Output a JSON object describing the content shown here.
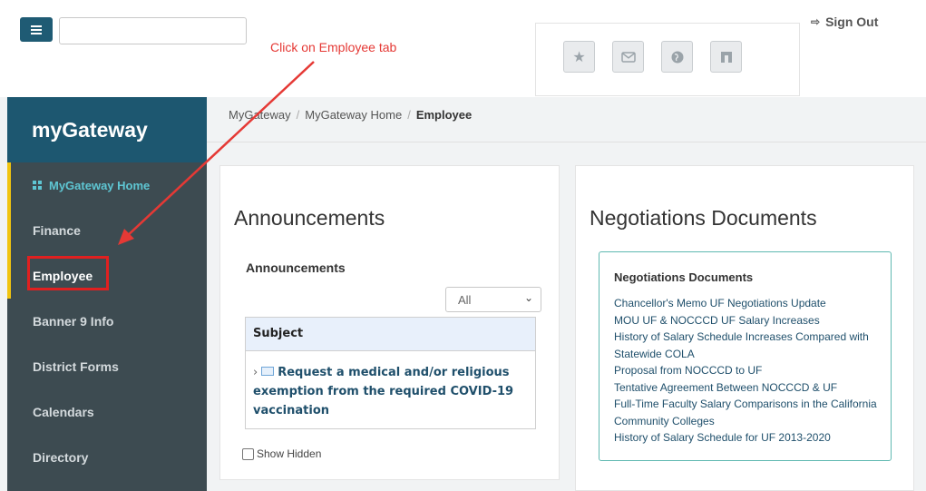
{
  "header": {
    "search_placeholder": "",
    "icons": [
      "star-icon",
      "mail-icon",
      "globe-icon",
      "app-icon"
    ],
    "sign_out_label": "Sign Out"
  },
  "annotation": {
    "text": "Click on Employee tab",
    "color": "#e53935"
  },
  "sidebar": {
    "brand": "myGateway",
    "items": [
      {
        "label": "MyGateway Home"
      },
      {
        "label": "Finance"
      },
      {
        "label": "Employee"
      },
      {
        "label": "Banner 9 Info"
      },
      {
        "label": "District Forms"
      },
      {
        "label": "Calendars"
      },
      {
        "label": "Directory"
      }
    ]
  },
  "breadcrumb": {
    "items": [
      "MyGateway",
      "MyGateway Home",
      "Employee"
    ]
  },
  "announcements": {
    "title": "Announcements",
    "subtitle": "Announcements",
    "filter_value": "All",
    "table_header": "Subject",
    "rows": [
      "Request a medical and/or religious exemption from the required COVID-19 vaccination"
    ],
    "show_hidden_label": "Show Hidden"
  },
  "negotiations": {
    "title": "Negotiations Documents",
    "box_title": "Negotiations Documents",
    "links": [
      "Chancellor's Memo UF Negotiations Update",
      "MOU UF & NOCCCD UF Salary Increases",
      "History of Salary Schedule Increases Compared with Statewide COLA",
      "Proposal from NOCCCD to UF",
      "Tentative Agreement Between NOCCCD & UF",
      "Full-Time Faculty Salary Comparisons in the California Community Colleges",
      "History of Salary Schedule for UF 2013-2020"
    ]
  },
  "colors": {
    "brand_bg": "#1d5770",
    "sidebar_bg": "#3d4b51",
    "accent_yellow": "#f1c40f",
    "home_teal": "#5ec6d3",
    "highlight_red": "#e02020"
  }
}
